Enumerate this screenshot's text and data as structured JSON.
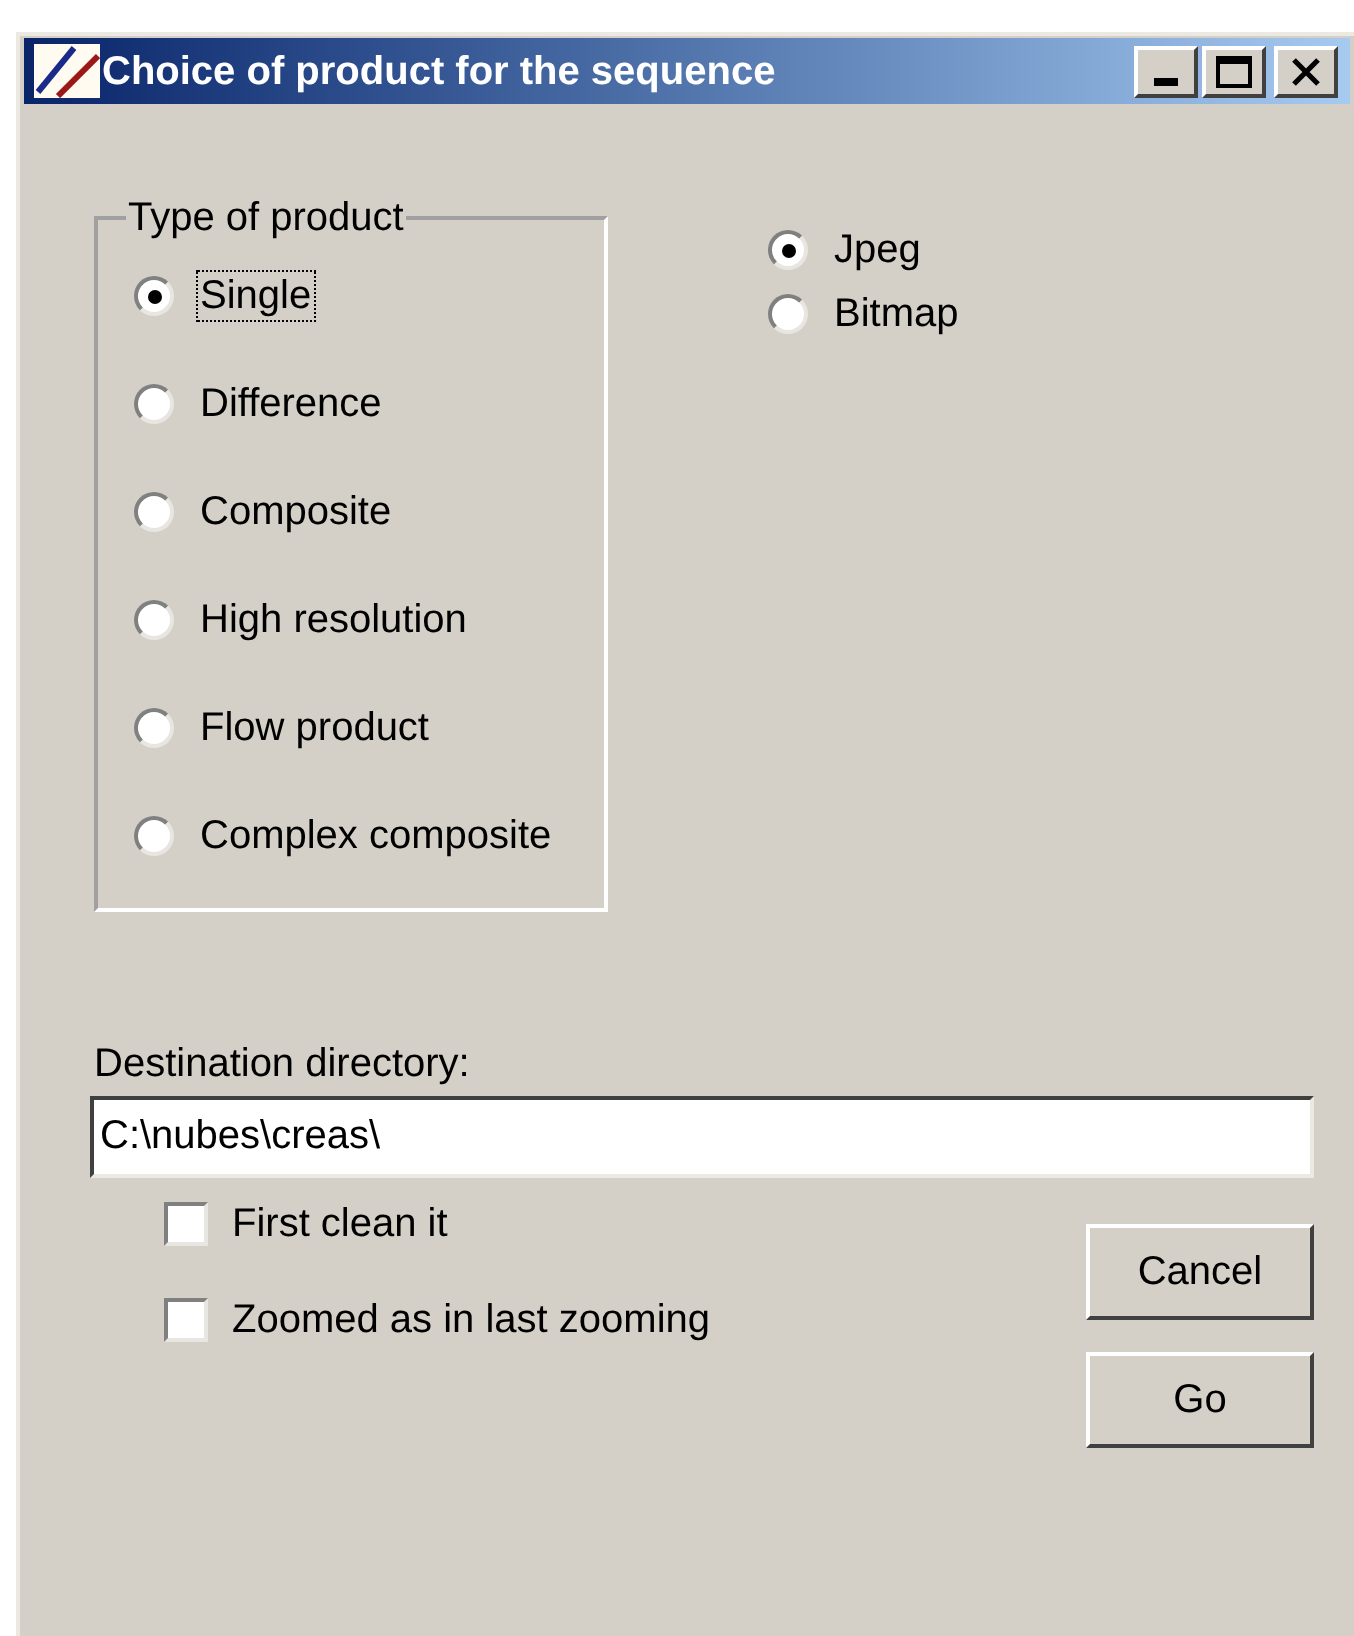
{
  "window": {
    "title": "Choice of product for the sequence"
  },
  "product_group": {
    "label": "Type of product",
    "options": [
      {
        "label": "Single",
        "selected": true,
        "focused": true
      },
      {
        "label": "Difference",
        "selected": false,
        "focused": false
      },
      {
        "label": "Composite",
        "selected": false,
        "focused": false
      },
      {
        "label": "High resolution",
        "selected": false,
        "focused": false
      },
      {
        "label": "Flow product",
        "selected": false,
        "focused": false
      },
      {
        "label": "Complex composite",
        "selected": false,
        "focused": false
      }
    ]
  },
  "formats": [
    {
      "label": "Jpeg",
      "selected": true
    },
    {
      "label": "Bitmap",
      "selected": false
    }
  ],
  "destination": {
    "label": "Destination directory:",
    "value": "C:\\nubes\\creas\\"
  },
  "options": [
    {
      "label": "First clean it",
      "checked": false
    },
    {
      "label": "Zoomed as in last zooming",
      "checked": false
    }
  ],
  "buttons": [
    "Cancel",
    "Go"
  ]
}
